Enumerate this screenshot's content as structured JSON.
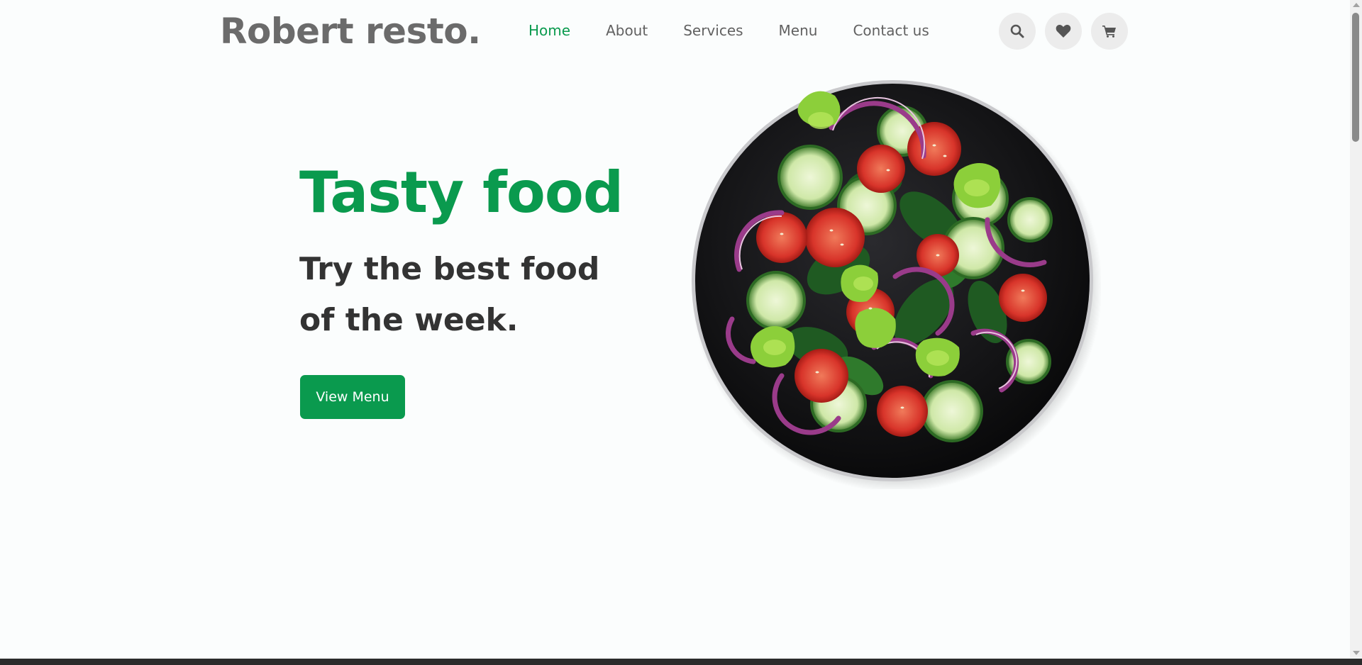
{
  "header": {
    "logo": "Robert resto.",
    "nav": [
      {
        "label": "Home",
        "active": true
      },
      {
        "label": "About",
        "active": false
      },
      {
        "label": "Services",
        "active": false
      },
      {
        "label": "Menu",
        "active": false
      },
      {
        "label": "Contact us",
        "active": false
      }
    ],
    "icons": [
      "search-icon",
      "heart-icon",
      "cart-icon"
    ]
  },
  "hero": {
    "title": "Tasty food",
    "subtitle": "Try the best food of the week.",
    "cta_label": "View Menu",
    "image": "salad-plate"
  },
  "colors": {
    "accent": "#0a9a4e",
    "text_dark": "#333333",
    "text_nav": "#616161",
    "logo": "#6b6b6b",
    "background": "#fbfdfd",
    "icon_bg": "#ececec"
  }
}
